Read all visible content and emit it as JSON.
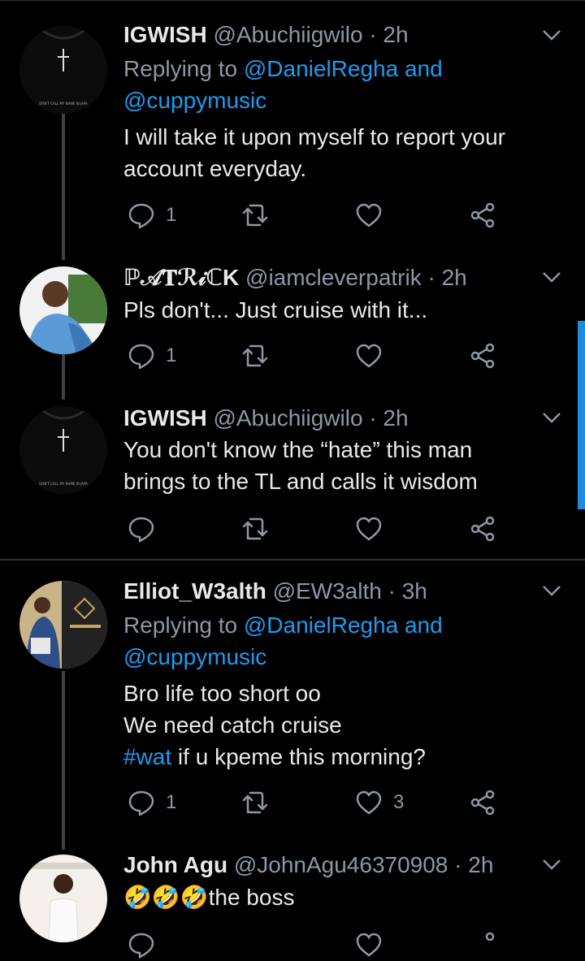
{
  "tweets": [
    {
      "name": "IGWISH",
      "handle": "@Abuchiigwilo",
      "time": "2h",
      "replying_prefix": "Replying to ",
      "replying_links": [
        "@DanielRegha and",
        "@cuppymusic"
      ],
      "text_lines": [
        "I will take it upon myself to report your",
        "account everyday."
      ],
      "reply_count": "1",
      "like_count": ""
    },
    {
      "name": "ℙ𝒜𝐓ℛ𝒾ℂK",
      "handle": "@iamcleverpatrik",
      "time": "2h",
      "text_lines": [
        "Pls don't... Just cruise with it..."
      ],
      "reply_count": "1",
      "like_count": ""
    },
    {
      "name": "IGWISH",
      "handle": "@Abuchiigwilo",
      "time": "2h",
      "text_lines": [
        "You don't know the “hate” this man",
        "brings to the TL and calls it wisdom"
      ],
      "reply_count": "",
      "like_count": ""
    },
    {
      "name": "Elliot_W3alth",
      "handle": "@EW3alth",
      "time": "3h",
      "replying_prefix": "Replying to ",
      "replying_links": [
        "@DanielRegha and",
        "@cuppymusic"
      ],
      "text_lines": [
        "Bro life too short oo",
        "We need catch cruise"
      ],
      "hashtag": "#wat",
      "text_tail": " if u kpeme this morning?",
      "reply_count": "1",
      "like_count": "3"
    },
    {
      "name": "John Agu",
      "handle": "@JohnAgu46370908",
      "time": "2h",
      "emoji": "🤣🤣🤣",
      "text_tail": "the boss"
    }
  ],
  "avatar_labels": {
    "igwish_shirt": "DON'T CALL MY NAME IN JAPA"
  },
  "separator": "·",
  "icons": [
    "reply-icon",
    "retweet-icon",
    "like-icon",
    "share-icon",
    "chevron-down-icon"
  ],
  "colors": {
    "background": "#000000",
    "link": "#1d9bf0",
    "secondary": "#8b98a5",
    "divider": "#2f3336"
  }
}
